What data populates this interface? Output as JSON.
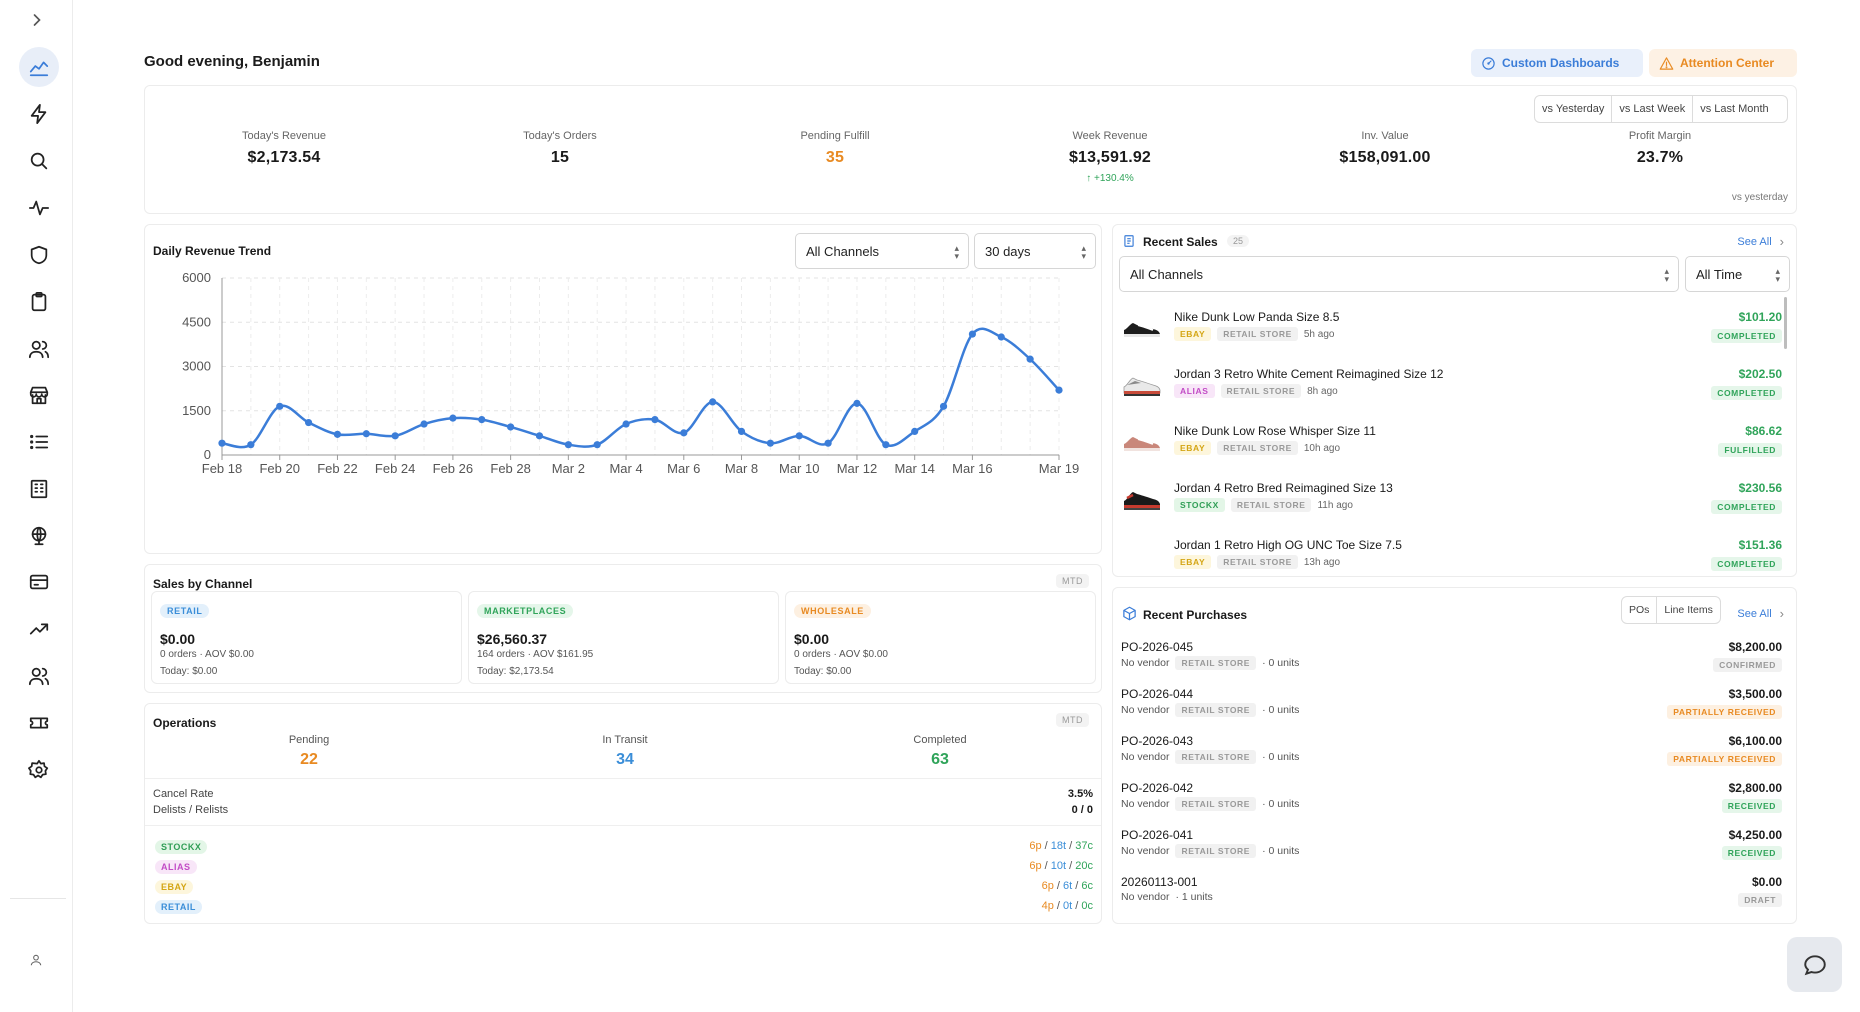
{
  "header": {
    "greeting": "Good evening, Benjamin",
    "custom_dashboards": "Custom Dashboards",
    "attention_center": "Attention Center"
  },
  "compare": [
    "vs Yesterday",
    "vs Last Week",
    "vs Last Month"
  ],
  "kpis": [
    {
      "label": "Today's Revenue",
      "value": "$2,173.54"
    },
    {
      "label": "Today's Orders",
      "value": "15"
    },
    {
      "label": "Pending Fulfill",
      "value": "35"
    },
    {
      "label": "Week Revenue",
      "value": "$13,591.92",
      "sub": "↑ +130.4%"
    },
    {
      "label": "Inv. Value",
      "value": "$158,091.00"
    },
    {
      "label": "Profit Margin",
      "value": "23.7%"
    }
  ],
  "vs_note": "vs yesterday",
  "revenue_chart": {
    "title": "Daily Revenue Trend",
    "channel_select": "All Channels",
    "range_select": "30 days"
  },
  "chart_data": {
    "type": "line",
    "title": "Daily Revenue Trend",
    "xlabel": "",
    "ylabel": "",
    "ylim": [
      0,
      6000
    ],
    "yticks": [
      0,
      1500,
      3000,
      4500,
      6000
    ],
    "xtick_labels": [
      "Feb 18",
      "Feb 20",
      "Feb 22",
      "Feb 24",
      "Feb 26",
      "Feb 28",
      "Mar 2",
      "Mar 4",
      "Mar 6",
      "Mar 8",
      "Mar 10",
      "Mar 12",
      "Mar 14",
      "Mar 16",
      "Mar 19"
    ],
    "x": [
      "Feb 18",
      "Feb 19",
      "Feb 20",
      "Feb 21",
      "Feb 22",
      "Feb 23",
      "Feb 24",
      "Feb 25",
      "Feb 26",
      "Feb 27",
      "Feb 28",
      "Mar 1",
      "Mar 2",
      "Mar 3",
      "Mar 4",
      "Mar 5",
      "Mar 6",
      "Mar 7",
      "Mar 8",
      "Mar 9",
      "Mar 10",
      "Mar 11",
      "Mar 12",
      "Mar 13",
      "Mar 14",
      "Mar 15",
      "Mar 16",
      "Mar 17",
      "Mar 18",
      "Mar 19"
    ],
    "series": [
      {
        "values": [
          400,
          350,
          1650,
          1100,
          700,
          720,
          650,
          1050,
          1250,
          1200,
          950,
          650,
          350,
          350,
          1050,
          1200,
          750,
          1800,
          800,
          400,
          650,
          400,
          1750,
          350,
          800,
          1650,
          4100,
          4000,
          3250,
          2200
        ]
      }
    ],
    "grid": true,
    "line_color": "#3b7dd8"
  },
  "channels": {
    "title": "Sales by Channel",
    "period": "MTD",
    "items": [
      {
        "tag": "RETAIL",
        "value": "$0.00",
        "line1": "0 orders · AOV $0.00",
        "line2": "Today: $0.00"
      },
      {
        "tag": "MARKETPLACES",
        "value": "$26,560.37",
        "line1": "164 orders · AOV $161.95",
        "line2": "Today: $2,173.54"
      },
      {
        "tag": "WHOLESALE",
        "value": "$0.00",
        "line1": "0 orders · AOV $0.00",
        "line2": "Today: $0.00"
      }
    ]
  },
  "operations": {
    "title": "Operations",
    "period": "MTD",
    "stats": [
      {
        "label": "Pending",
        "value": "22"
      },
      {
        "label": "In Transit",
        "value": "34"
      },
      {
        "label": "Completed",
        "value": "63"
      }
    ],
    "cancel_rate_label": "Cancel Rate",
    "cancel_rate": "3.5%",
    "delists_label": "Delists / Relists",
    "delists": "0 / 0",
    "platforms": [
      {
        "tag": "STOCKX",
        "p": "6p",
        "t": "18t",
        "c": "37c"
      },
      {
        "tag": "ALIAS",
        "p": "6p",
        "t": "10t",
        "c": "20c"
      },
      {
        "tag": "EBAY",
        "p": "6p",
        "t": "6t",
        "c": "6c"
      },
      {
        "tag": "RETAIL",
        "p": "4p",
        "t": "0t",
        "c": "0c"
      }
    ]
  },
  "recent_sales": {
    "title": "Recent Sales",
    "count": "25",
    "see_all": "See All",
    "channel_select": "All Channels",
    "time_select": "All Time",
    "items": [
      {
        "name": "Nike Dunk Low Panda Size 8.5",
        "platform": "EBAY",
        "store": "RETAIL STORE",
        "time": "5h ago",
        "amount": "$101.20",
        "status": "COMPLETED"
      },
      {
        "name": "Jordan 3 Retro White Cement Reimagined Size 12",
        "platform": "ALIAS",
        "store": "RETAIL STORE",
        "time": "8h ago",
        "amount": "$202.50",
        "status": "COMPLETED"
      },
      {
        "name": "Nike Dunk Low Rose Whisper Size 11",
        "platform": "EBAY",
        "store": "RETAIL STORE",
        "time": "10h ago",
        "amount": "$86.62",
        "status": "FULFILLED"
      },
      {
        "name": "Jordan 4 Retro Bred Reimagined Size 13",
        "platform": "STOCKX",
        "store": "RETAIL STORE",
        "time": "11h ago",
        "amount": "$230.56",
        "status": "COMPLETED"
      },
      {
        "name": "Jordan 1 Retro High OG UNC Toe Size 7.5",
        "platform": "EBAY",
        "store": "RETAIL STORE",
        "time": "13h ago",
        "amount": "$151.36",
        "status": "COMPLETED"
      }
    ]
  },
  "recent_purchases": {
    "title": "Recent Purchases",
    "toggle": [
      "POs",
      "Line Items"
    ],
    "see_all": "See All",
    "items": [
      {
        "id": "PO-2026-045",
        "vendor": "No vendor",
        "store": "RETAIL STORE",
        "units": "· 0 units",
        "amount": "$8,200.00",
        "status": "CONFIRMED"
      },
      {
        "id": "PO-2026-044",
        "vendor": "No vendor",
        "store": "RETAIL STORE",
        "units": "· 0 units",
        "amount": "$3,500.00",
        "status": "PARTIALLY RECEIVED"
      },
      {
        "id": "PO-2026-043",
        "vendor": "No vendor",
        "store": "RETAIL STORE",
        "units": "· 0 units",
        "amount": "$6,100.00",
        "status": "PARTIALLY RECEIVED"
      },
      {
        "id": "PO-2026-042",
        "vendor": "No vendor",
        "store": "RETAIL STORE",
        "units": "· 0 units",
        "amount": "$2,800.00",
        "status": "RECEIVED"
      },
      {
        "id": "PO-2026-041",
        "vendor": "No vendor",
        "store": "RETAIL STORE",
        "units": "· 0 units",
        "amount": "$4,250.00",
        "status": "RECEIVED"
      },
      {
        "id": "20260113-001",
        "vendor": "No vendor",
        "store": "",
        "units": "· 1 units",
        "amount": "$0.00",
        "status": "DRAFT"
      }
    ]
  },
  "sidebar": {
    "icons": [
      "analytics-icon",
      "bolt-icon",
      "search-icon",
      "activity-icon",
      "shield-icon",
      "clipboard-icon",
      "users-icon",
      "store-icon",
      "list-icon",
      "building-icon",
      "globe-icon",
      "card-icon",
      "trending-up-icon",
      "team-icon",
      "ticket-icon",
      "gear-icon"
    ]
  },
  "colors": {
    "accent_blue": "#3b7dd8",
    "accent_orange": "#e88a22",
    "success_green": "#30a45a"
  }
}
